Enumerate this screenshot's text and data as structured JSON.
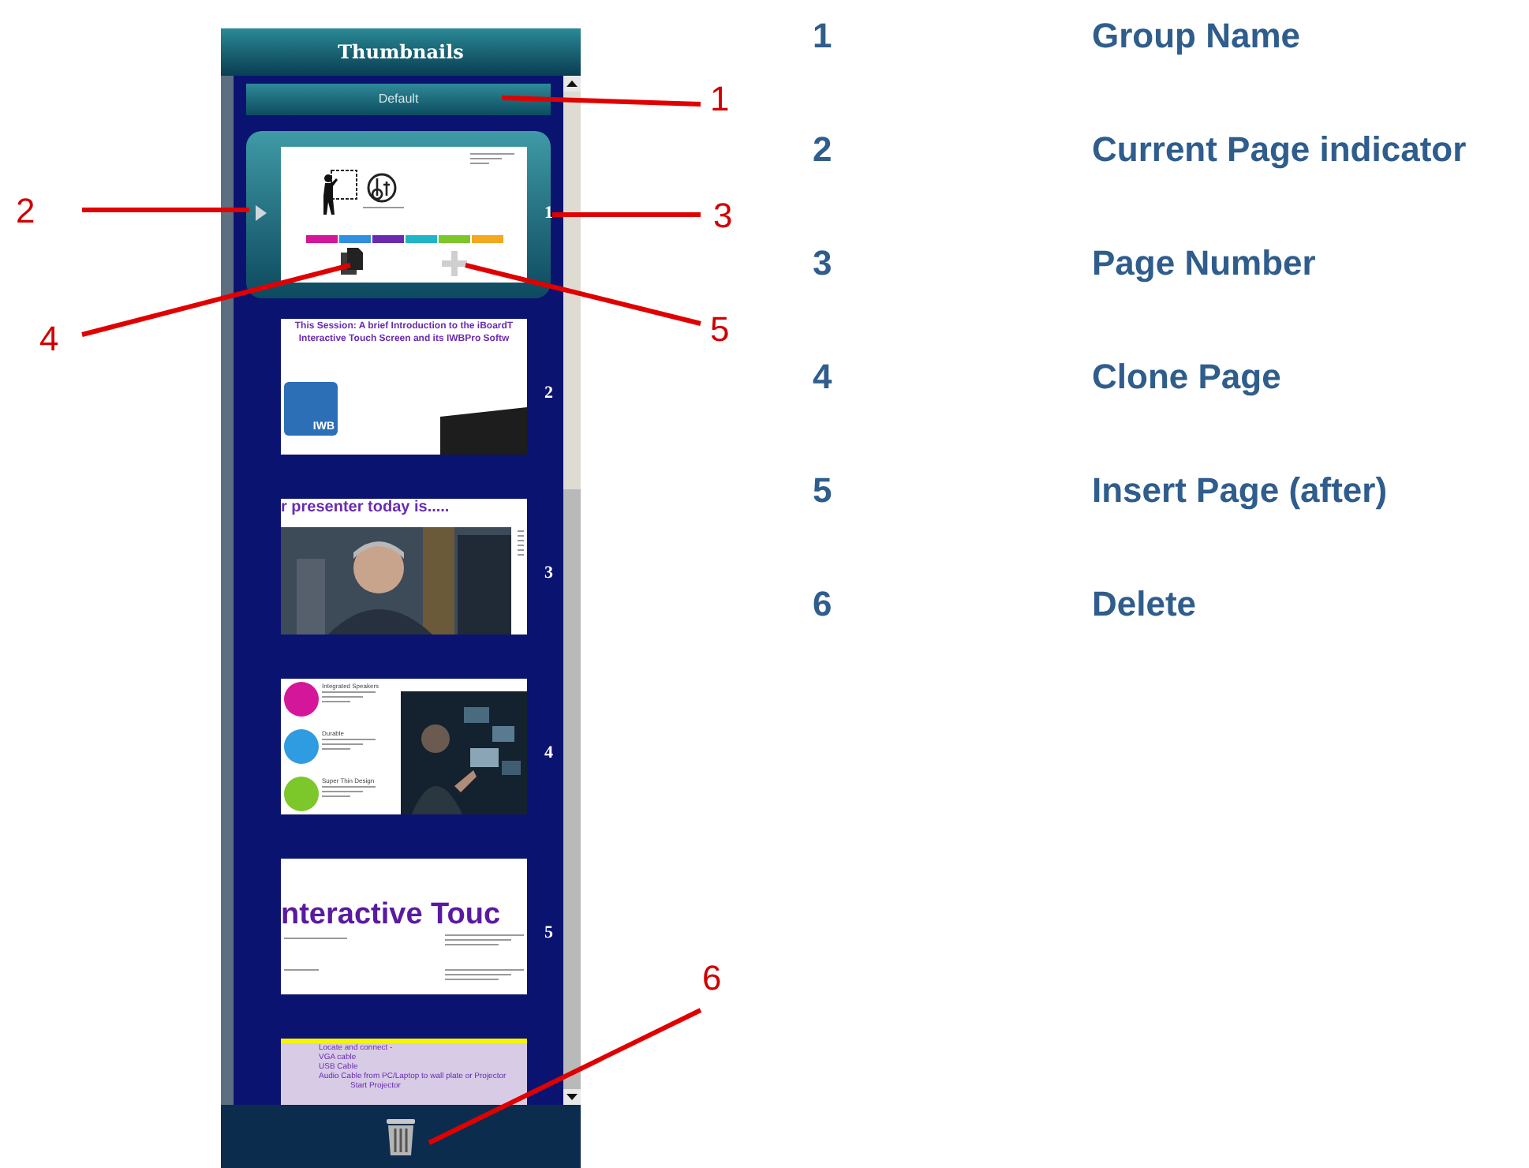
{
  "panel": {
    "title": "Thumbnails",
    "group_name": "Default",
    "pages": [
      {
        "number": "1",
        "selected": true,
        "slide": {
          "kind": "title-logo"
        }
      },
      {
        "number": "2",
        "selected": false,
        "slide": {
          "kind": "intro",
          "lines": [
            "This Session: A brief Introduction to the iBoardT",
            "Interactive Touch Screen and its IWBPro Softw"
          ],
          "logo_text": "IWB"
        }
      },
      {
        "number": "3",
        "selected": false,
        "slide": {
          "kind": "presenter",
          "lines": [
            "r presenter today is....."
          ]
        }
      },
      {
        "number": "4",
        "selected": false,
        "slide": {
          "kind": "features",
          "lines": [
            "Integrated Speakers",
            "Durable",
            "Super Thin Design"
          ]
        }
      },
      {
        "number": "5",
        "selected": false,
        "slide": {
          "kind": "touch",
          "lines": [
            "nteractive Touc"
          ]
        }
      },
      {
        "selected": false,
        "slide": {
          "kind": "checklist",
          "lines": [
            "Locate and connect -",
            "VGA cable",
            "USB Cable",
            "Audio Cable from PC/Laptop to wall plate or Projector",
            "Start Projector"
          ]
        }
      }
    ]
  },
  "callouts": [
    {
      "number": "1"
    },
    {
      "number": "2"
    },
    {
      "number": "3"
    },
    {
      "number": "4"
    },
    {
      "number": "5"
    },
    {
      "number": "6"
    }
  ],
  "legend": [
    {
      "number": "1",
      "label": "Group Name"
    },
    {
      "number": "2",
      "label": "Current Page indicator"
    },
    {
      "number": "3",
      "label": "Page Number"
    },
    {
      "number": "4",
      "label": "Clone Page"
    },
    {
      "number": "5",
      "label": "Insert Page (after)"
    },
    {
      "number": "6",
      "label": "Delete"
    }
  ]
}
